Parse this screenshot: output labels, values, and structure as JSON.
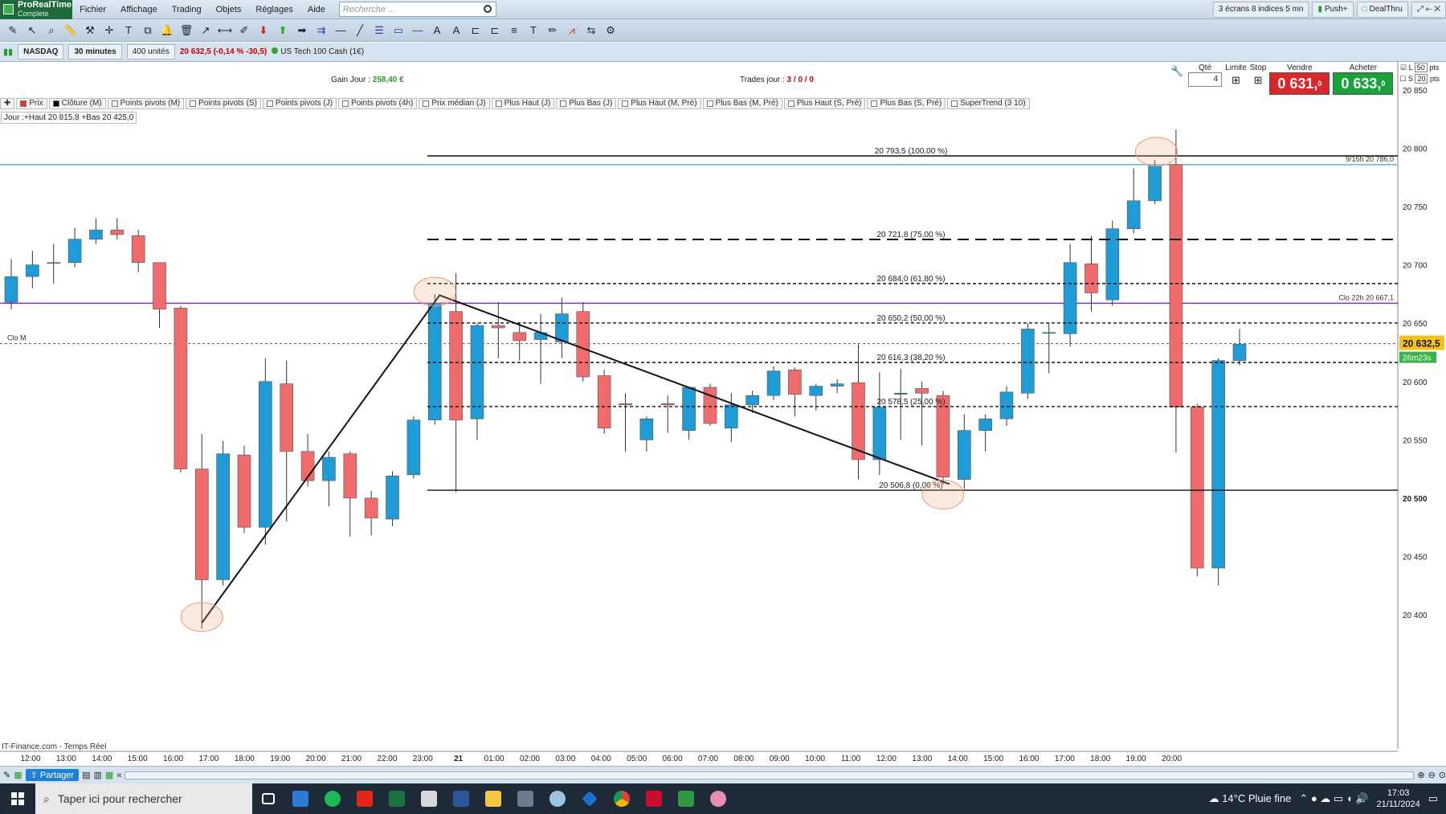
{
  "app": {
    "name": "ProRealTime",
    "edition": "Complete"
  },
  "menu": [
    "Fichier",
    "Affichage",
    "Trading",
    "Objets",
    "Réglages",
    "Aide"
  ],
  "search": {
    "placeholder": "Recherche ..."
  },
  "topright": {
    "layout": "3 écrans 8 indices 5 mn",
    "push": "Push+",
    "dealthru": "DealThru"
  },
  "instrument": {
    "market": "NASDAQ",
    "timeframe": "30 minutes",
    "units": "400 unités",
    "last": "20 632,5 (-0,14 % -30,5)",
    "name": "US Tech 100 Cash (1€)"
  },
  "stats": {
    "gain_label": "Gain Jour :",
    "gain_value": "258,40 €",
    "trades_label": "Trades jour :",
    "trades_value": "3 / 0 / 0"
  },
  "order": {
    "qty_label": "Qté",
    "qty": "4",
    "limit_label": "Limite",
    "stop_label": "Stop",
    "sell_label": "Vendre",
    "buy_label": "Acheter",
    "sell_price": "0 631,",
    "buy_price": "0 633,",
    "sell_sup": "0",
    "buy_sup": "0",
    "l": "L",
    "s": "S",
    "pts1": "50",
    "pts2": "20",
    "pts": "pts"
  },
  "indicators": [
    "Prix",
    "Clôture (M)",
    "Points pivots (M)",
    "Points pivots (S)",
    "Points pivots (J)",
    "Points pivots (4h)",
    "Prix médian (J)",
    "Plus Haut (J)",
    "Plus Bas (J)",
    "Plus Haut (M, Pré)",
    "Plus Bas (M, Pré)",
    "Plus Haut (S, Pré)",
    "Plus Bas (S, Pré)",
    "SuperTrend (3 10)"
  ],
  "dayinfo": "Jour :+Haut 20 815,8 +Bas 20 425,0",
  "watermark": "IT-Finance.com - Temps Réel",
  "labels": {
    "clo_m": "Clo M",
    "h15": "9/15h 20 786,0",
    "clo22": "Clo 22h 20 667,1",
    "price_tag": "20 632,5",
    "timer": "26m23s"
  },
  "fib": [
    {
      "label": "20 793,5 (100,00 %)",
      "value": 20793.5,
      "style": "solid"
    },
    {
      "label": "20 721,8 (75,00 %)",
      "value": 20721.8,
      "style": "dash"
    },
    {
      "label": "20 684,0 (61,80 %)",
      "value": 20684.0,
      "style": "dot"
    },
    {
      "label": "20 650,2 (50,00 %)",
      "value": 20650.2,
      "style": "dot"
    },
    {
      "label": "20 616,3 (38,20 %)",
      "value": 20616.3,
      "style": "dot"
    },
    {
      "label": "20 578,5 (25,00 %)",
      "value": 20578.5,
      "style": "dot"
    },
    {
      "label": "20 506,8 (0,00 %)",
      "value": 20506.8,
      "style": "solid"
    }
  ],
  "chart_data": {
    "type": "candlestick",
    "y_ticks": [
      20850,
      20800,
      20750,
      20700,
      20650,
      20600,
      20550,
      20500,
      20450,
      20400
    ],
    "y_tick_labels": [
      "20 850",
      "20 800",
      "20 750",
      "20 700",
      "20 650",
      "20 600",
      "20 550",
      "20 500",
      "20 450",
      "20 400"
    ],
    "x_labels": [
      "12:00",
      "13:00",
      "14:00",
      "15:00",
      "16:00",
      "17:00",
      "18:00",
      "19:00",
      "20:00",
      "21:00",
      "22:00",
      "23:00",
      "21",
      "01:00",
      "02:00",
      "03:00",
      "04:00",
      "05:00",
      "06:00",
      "07:00",
      "08:00",
      "09:00",
      "10:00",
      "11:00",
      "12:00",
      "13:00",
      "14:00",
      "15:00",
      "16:00",
      "17:00",
      "18:00",
      "19:00",
      "20:00"
    ],
    "candles": [
      {
        "o": 20668,
        "h": 20705,
        "l": 20662,
        "c": 20690
      },
      {
        "o": 20690,
        "h": 20712,
        "l": 20680,
        "c": 20700
      },
      {
        "o": 20702,
        "h": 20718,
        "l": 20684,
        "c": 20702
      },
      {
        "o": 20702,
        "h": 20732,
        "l": 20698,
        "c": 20722
      },
      {
        "o": 20722,
        "h": 20740,
        "l": 20718,
        "c": 20730
      },
      {
        "o": 20730,
        "h": 20740,
        "l": 20722,
        "c": 20726
      },
      {
        "o": 20725,
        "h": 20730,
        "l": 20694,
        "c": 20702
      },
      {
        "o": 20702,
        "h": 20702,
        "l": 20646,
        "c": 20662
      },
      {
        "o": 20663,
        "h": 20665,
        "l": 20522,
        "c": 20525
      },
      {
        "o": 20525,
        "h": 20555,
        "l": 20388,
        "c": 20430
      },
      {
        "o": 20430,
        "h": 20549,
        "l": 20425,
        "c": 20538
      },
      {
        "o": 20537,
        "h": 20545,
        "l": 20470,
        "c": 20475
      },
      {
        "o": 20475,
        "h": 20620,
        "l": 20460,
        "c": 20600
      },
      {
        "o": 20598,
        "h": 20618,
        "l": 20480,
        "c": 20540
      },
      {
        "o": 20540,
        "h": 20555,
        "l": 20510,
        "c": 20515
      },
      {
        "o": 20515,
        "h": 20540,
        "l": 20493,
        "c": 20535
      },
      {
        "o": 20538,
        "h": 20540,
        "l": 20467,
        "c": 20500
      },
      {
        "o": 20500,
        "h": 20506,
        "l": 20468,
        "c": 20483
      },
      {
        "o": 20482,
        "h": 20523,
        "l": 20476,
        "c": 20519
      },
      {
        "o": 20520,
        "h": 20570,
        "l": 20517,
        "c": 20567
      },
      {
        "o": 20567,
        "h": 20675,
        "l": 20563,
        "c": 20667
      },
      {
        "o": 20660,
        "h": 20693,
        "l": 20505,
        "c": 20567
      },
      {
        "o": 20568,
        "h": 20650,
        "l": 20550,
        "c": 20648
      },
      {
        "o": 20648,
        "h": 20668,
        "l": 20620,
        "c": 20646
      },
      {
        "o": 20642,
        "h": 20650,
        "l": 20618,
        "c": 20635
      },
      {
        "o": 20636,
        "h": 20658,
        "l": 20598,
        "c": 20642
      },
      {
        "o": 20634,
        "h": 20672,
        "l": 20620,
        "c": 20658
      },
      {
        "o": 20660,
        "h": 20668,
        "l": 20600,
        "c": 20604
      },
      {
        "o": 20605,
        "h": 20610,
        "l": 20555,
        "c": 20560
      },
      {
        "o": 20581,
        "h": 20590,
        "l": 20540,
        "c": 20580
      },
      {
        "o": 20550,
        "h": 20570,
        "l": 20540,
        "c": 20568
      },
      {
        "o": 20581,
        "h": 20588,
        "l": 20556,
        "c": 20580
      },
      {
        "o": 20558,
        "h": 20572,
        "l": 20550,
        "c": 20595
      },
      {
        "o": 20595,
        "h": 20598,
        "l": 20562,
        "c": 20564
      },
      {
        "o": 20560,
        "h": 20590,
        "l": 20548,
        "c": 20580
      },
      {
        "o": 20580,
        "h": 20592,
        "l": 20573,
        "c": 20588
      },
      {
        "o": 20588,
        "h": 20613,
        "l": 20584,
        "c": 20609
      },
      {
        "o": 20610,
        "h": 20612,
        "l": 20570,
        "c": 20589
      },
      {
        "o": 20588,
        "h": 20598,
        "l": 20575,
        "c": 20596
      },
      {
        "o": 20596,
        "h": 20602,
        "l": 20590,
        "c": 20598
      },
      {
        "o": 20599,
        "h": 20632,
        "l": 20516,
        "c": 20533
      },
      {
        "o": 20533,
        "h": 20608,
        "l": 20520,
        "c": 20578
      },
      {
        "o": 20589,
        "h": 20611,
        "l": 20550,
        "c": 20590
      },
      {
        "o": 20594,
        "h": 20600,
        "l": 20545,
        "c": 20590
      },
      {
        "o": 20588,
        "h": 20592,
        "l": 20512,
        "c": 20518
      },
      {
        "o": 20516,
        "h": 20572,
        "l": 20508,
        "c": 20558
      },
      {
        "o": 20558,
        "h": 20572,
        "l": 20540,
        "c": 20568
      },
      {
        "o": 20568,
        "h": 20596,
        "l": 20562,
        "c": 20591
      },
      {
        "o": 20590,
        "h": 20650,
        "l": 20585,
        "c": 20645
      },
      {
        "o": 20642,
        "h": 20650,
        "l": 20607,
        "c": 20642
      },
      {
        "o": 20641,
        "h": 20718,
        "l": 20630,
        "c": 20702
      },
      {
        "o": 20701,
        "h": 20725,
        "l": 20660,
        "c": 20676
      },
      {
        "o": 20670,
        "h": 20738,
        "l": 20665,
        "c": 20731
      },
      {
        "o": 20731,
        "h": 20783,
        "l": 20727,
        "c": 20755
      },
      {
        "o": 20755,
        "h": 20790,
        "l": 20752,
        "c": 20785
      },
      {
        "o": 20786,
        "h": 20816,
        "l": 20539,
        "c": 20578
      },
      {
        "o": 20578,
        "h": 20581,
        "l": 20433,
        "c": 20440
      },
      {
        "o": 20440,
        "h": 20620,
        "l": 20425,
        "c": 20618
      },
      {
        "o": 20618,
        "h": 20645,
        "l": 20614,
        "c": 20632
      }
    ]
  }
}
